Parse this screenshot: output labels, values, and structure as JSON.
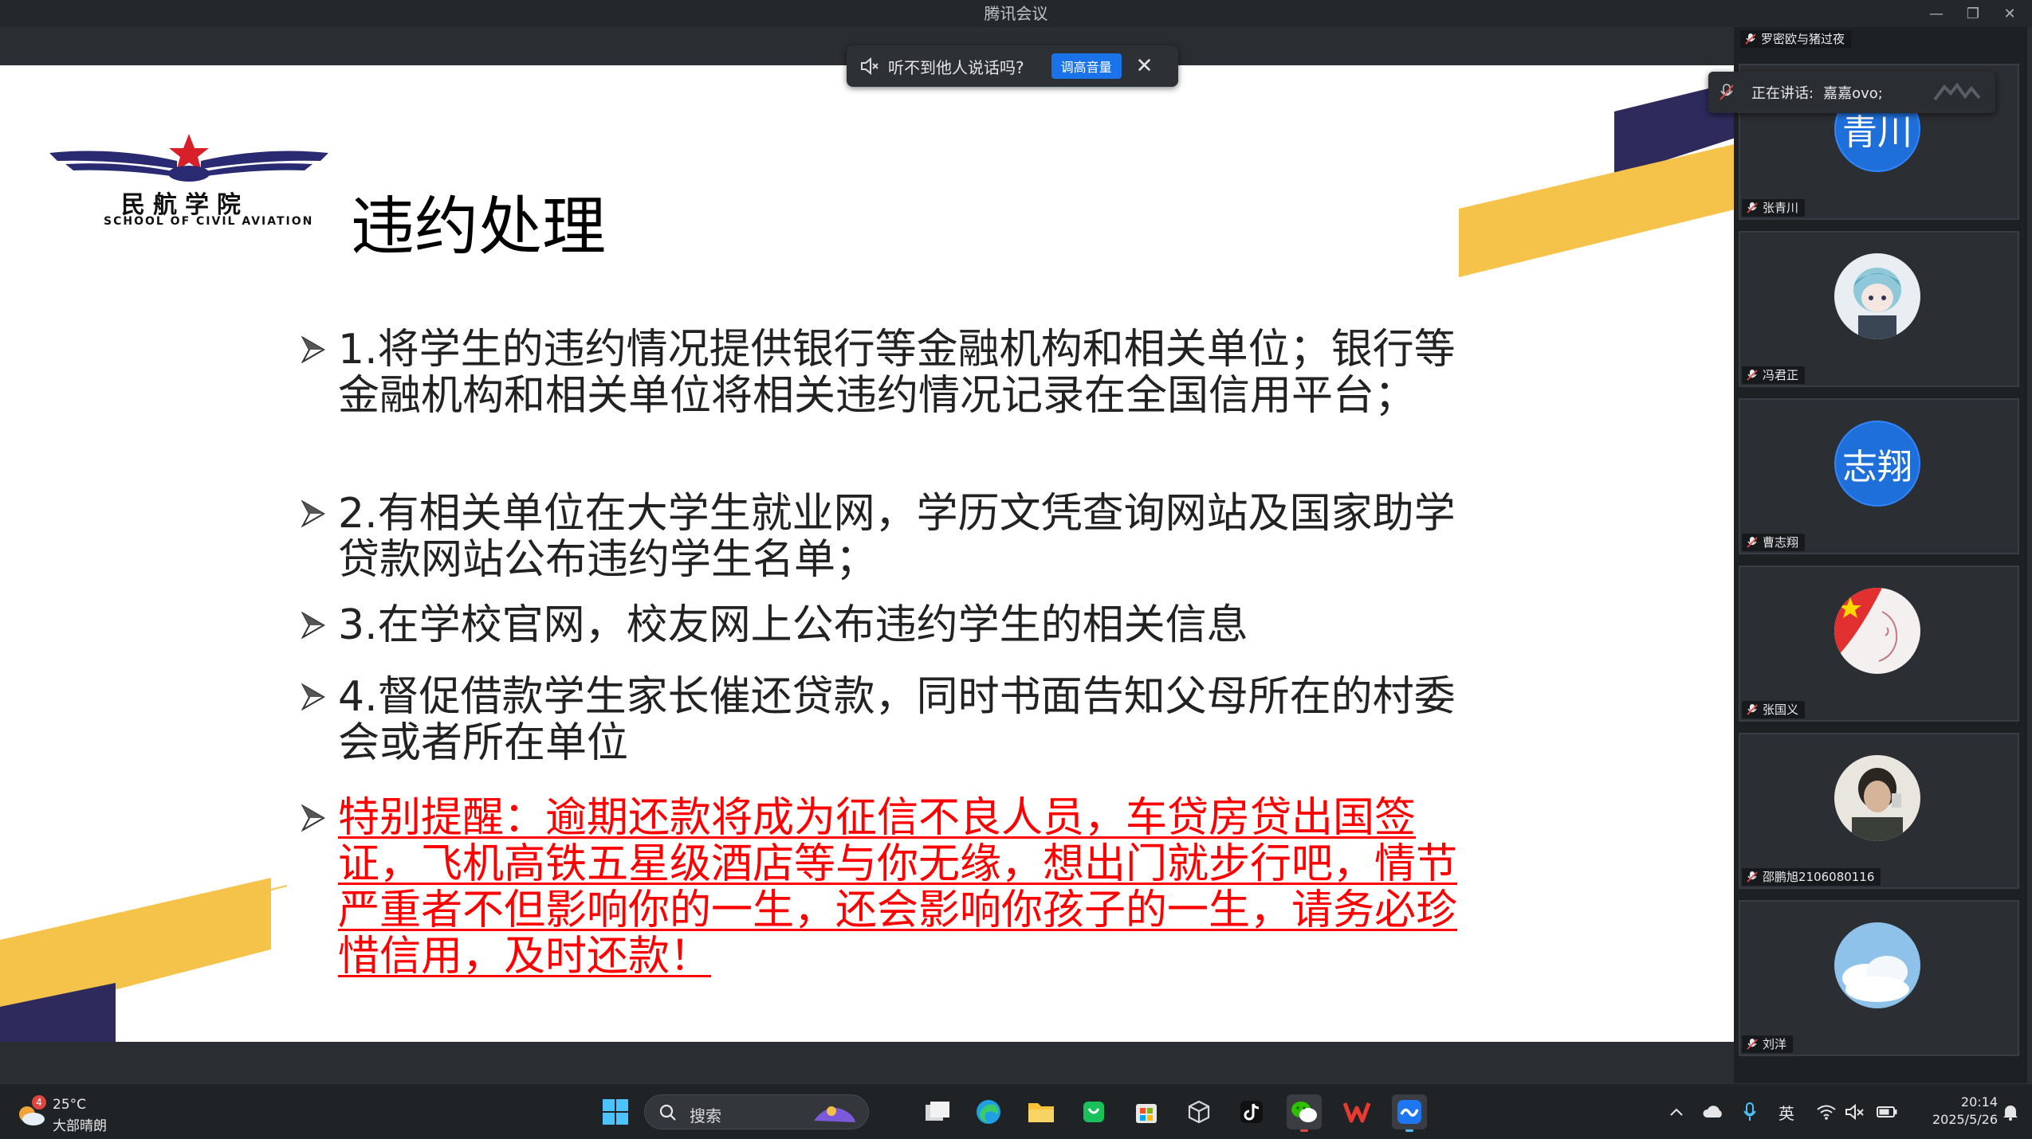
{
  "window": {
    "title": "腾讯会议"
  },
  "notice": {
    "text": "听不到他人说话吗?",
    "button": "调高音量"
  },
  "slide": {
    "logo_cn": "民航学院",
    "logo_en": "SCHOOL OF CIVIL AVIATION",
    "title": "违约处理",
    "bullets": [
      "1.将学生的违约情况提供银行等金融机构和相关单位；银行等金融机构和相关单位将相关违约情况记录在全国信用平台；",
      "2.有相关单位在大学生就业网，学历文凭查询网站及国家助学贷款网站公布违约学生名单；",
      "3.在学校官网，校友网上公布违约学生的相关信息",
      "4.督促借款学生家长催还贷款，同时书面告知父母所在的村委会或者所在单位"
    ],
    "warning": "特别提醒：逾期还款将成为征信不良人员，车贷房贷出国签证，飞机高铁五星级酒店等与你无缘，想出门就步行吧，情节严重者不但影响你的一生，还会影响你孩子的一生，请务必珍惜信用，及时还款！"
  },
  "speaking": {
    "label": "正在讲话:",
    "name": "嘉嘉ovo;"
  },
  "participants": {
    "top_name": "罗密欧与猪过夜",
    "tiles": [
      {
        "name": "张青川",
        "avatar_text": "青川"
      },
      {
        "name": "冯君正",
        "avatar_icon": "anime-avatar-icon"
      },
      {
        "name": "曹志翔",
        "avatar_text": "志翔"
      },
      {
        "name": "张国义",
        "avatar_icon": "flag-avatar-icon"
      },
      {
        "name": "邵鹏旭2106080116",
        "avatar_icon": "photo-avatar-icon"
      },
      {
        "name": "刘洋",
        "avatar_icon": "sky-avatar-icon"
      }
    ]
  },
  "taskbar": {
    "weather_temp": "25°C",
    "weather_desc": "大部晴朗",
    "weather_badge": "4",
    "search_placeholder": "搜索",
    "ime": "英",
    "time": "20:14",
    "date": "2025/5/26"
  },
  "colors": {
    "accent": "#1e6fd9",
    "warning": "#ff0000",
    "deco_yellow": "#f5c24a",
    "deco_navy": "#2e2a5c"
  }
}
